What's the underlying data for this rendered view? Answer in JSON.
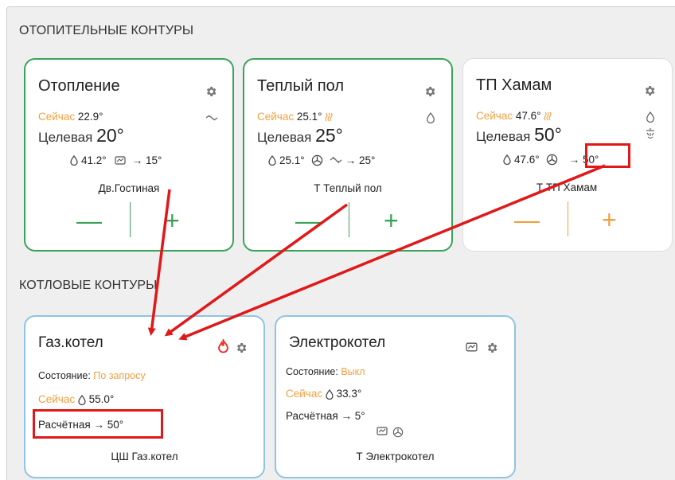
{
  "sections": {
    "heating": "ОТОПИТЕЛЬНЫЕ КОНТУРЫ",
    "boilers": "КОТЛОВЫЕ КОНТУРЫ"
  },
  "heating_cards": [
    {
      "title": "Отопление",
      "now_label": "Сейчас",
      "now_value": "22.9°",
      "target_label": "Целевая",
      "target_value": "20°",
      "info_temp": "41.2°",
      "info_target": "→ 15°",
      "sensor": "Дв.Гостиная",
      "minus": "—",
      "plus": "+"
    },
    {
      "title": "Теплый пол",
      "now_label": "Сейчас",
      "now_value": "25.1°",
      "target_label": "Целевая",
      "target_value": "25°",
      "info_temp": "25.1°",
      "info_target": "→ 25°",
      "sensor": "Т Теплый пол",
      "minus": "—",
      "plus": "+"
    },
    {
      "title": "ТП Хамам",
      "now_label": "Сейчас",
      "now_value": "47.6°",
      "target_label": "Целевая",
      "target_value": "50°",
      "info_temp": "47.6°",
      "info_target": "→ 50°",
      "sensor": "Т ТП Хамам",
      "minus": "—",
      "plus": "+"
    }
  ],
  "boiler_cards": [
    {
      "title": "Газ.котел",
      "status_label": "Состояние:",
      "status_value": "По запросу",
      "now_label": "Сейчас",
      "now_value": "55.0°",
      "calc_label": "Расчётная",
      "calc_value": "→ 50°",
      "sensor": "ЦШ Газ.котел"
    },
    {
      "title": "Электрокотел",
      "status_label": "Состояние:",
      "status_value": "Выкл",
      "now_label": "Сейчас",
      "now_value": "33.3°",
      "calc_label": "Расчётная",
      "calc_value": "→ 5°",
      "sensor": "Т Электрокотел"
    }
  ],
  "colors": {
    "accent_orange": "#f0a040",
    "green": "#3aa35a",
    "blue_border": "#8ec4e4",
    "annotation_red": "#e01818",
    "flame_red": "#e8322a"
  }
}
